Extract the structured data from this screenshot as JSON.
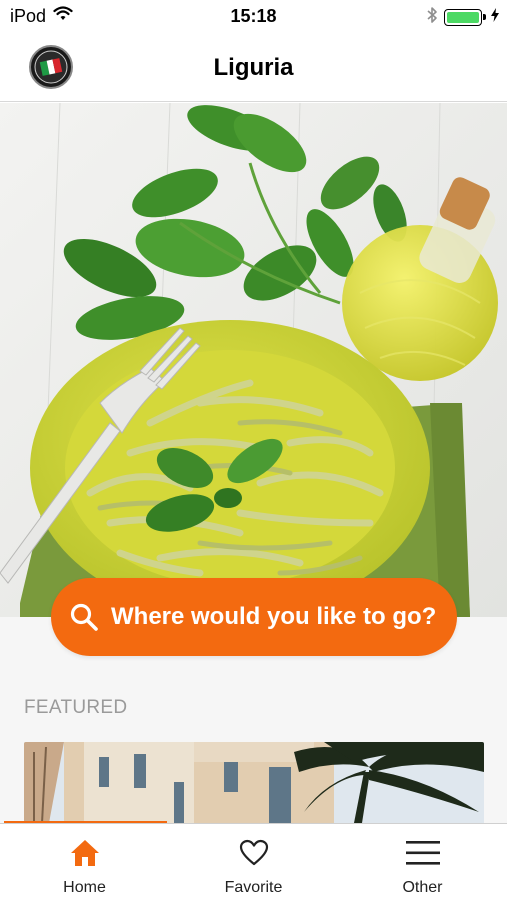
{
  "status_bar": {
    "carrier": "iPod",
    "time": "15:18",
    "icons": [
      "wifi-icon",
      "bluetooth-icon",
      "battery-icon",
      "charging-icon"
    ],
    "battery_color": "#4cd964"
  },
  "nav": {
    "title": "Liguria",
    "logo_icon": "italy-flag-badge-icon"
  },
  "hero": {
    "image": "pesto-pasta-basil-olive-oil-photo"
  },
  "search": {
    "label": "Where would you like to go?",
    "icon": "search-icon",
    "color": "#f36a10"
  },
  "featured": {
    "title": "FEATURED",
    "card_image": "building-with-palm-tree-photo"
  },
  "tabs": [
    {
      "label": "Home",
      "icon": "home-icon",
      "active": true
    },
    {
      "label": "Favorite",
      "icon": "heart-icon",
      "active": false
    },
    {
      "label": "Other",
      "icon": "menu-icon",
      "active": false
    }
  ],
  "colors": {
    "accent": "#f36a10",
    "muted_text": "#9a9a9a"
  }
}
